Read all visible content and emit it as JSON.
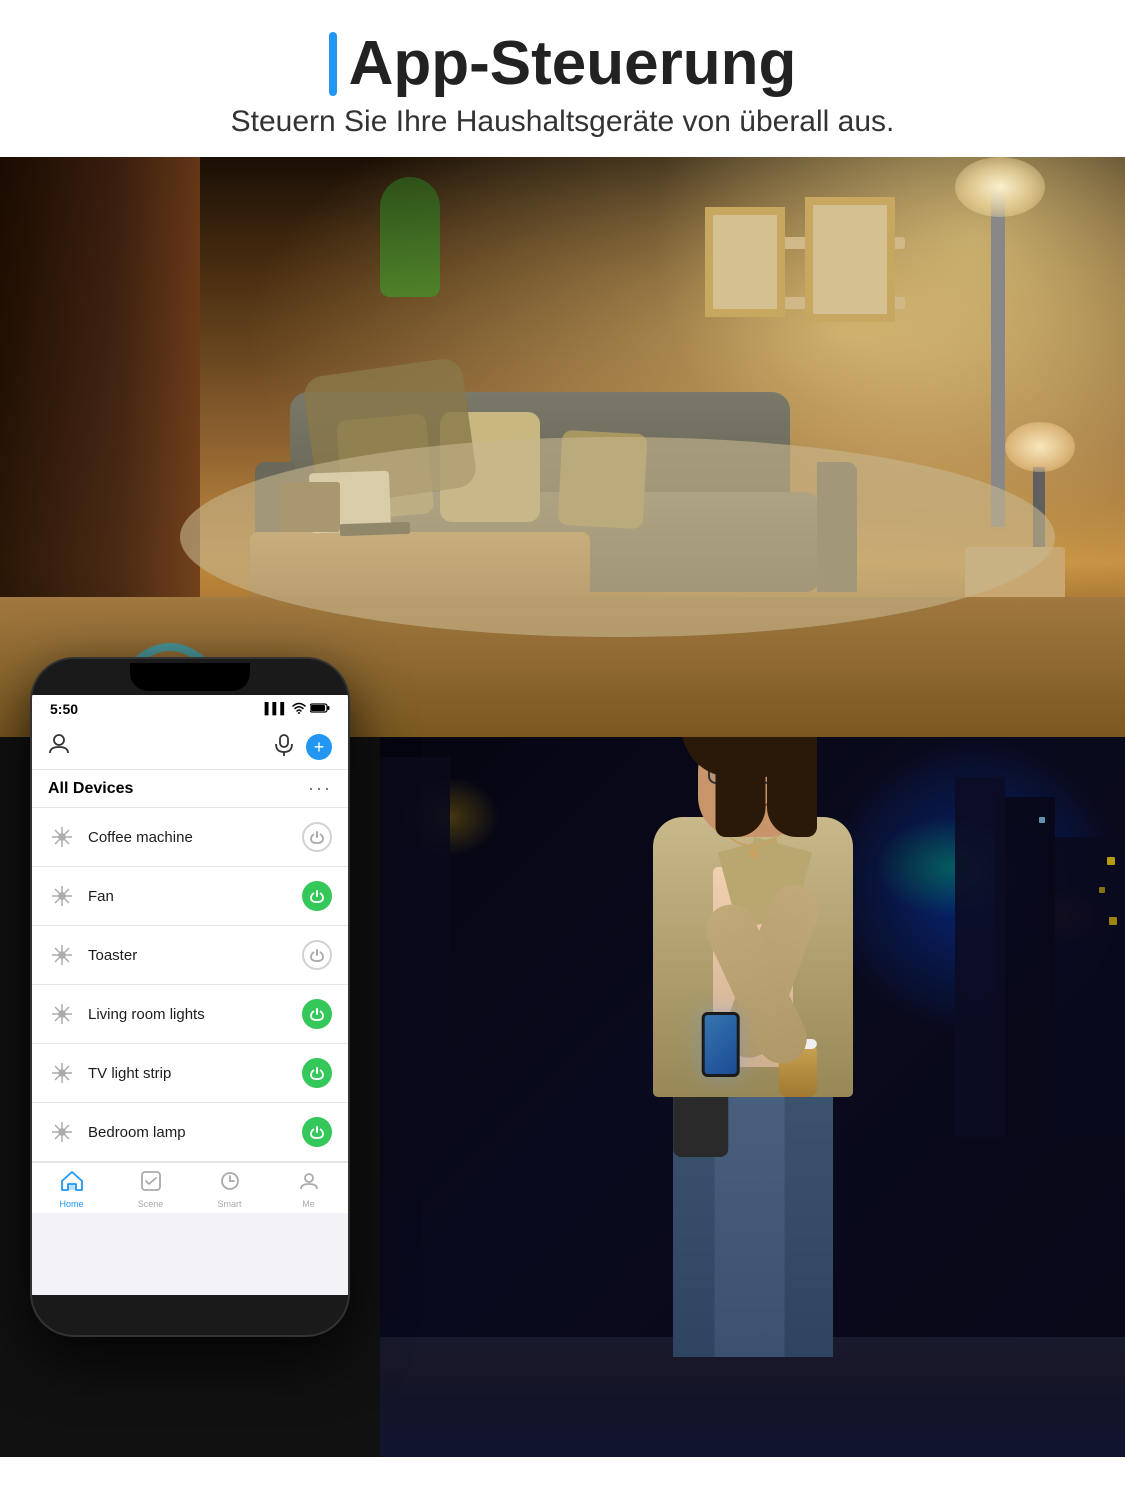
{
  "header": {
    "title": "App-Steuerung",
    "blue_bar": "|",
    "subtitle": "Steuern Sie Ihre Haushaltsgeräte von überall aus."
  },
  "phone": {
    "status": {
      "time": "5:50",
      "signal": "▌▌▌",
      "wifi": "WiFi",
      "battery": "🔋"
    },
    "app_header": {
      "user_icon": "👤",
      "mic_icon": "🎙",
      "plus_icon": "+"
    },
    "devices_section": {
      "title": "All Devices",
      "dots": "···",
      "devices": [
        {
          "name": "Coffee machine",
          "on": false,
          "icon": "❄"
        },
        {
          "name": "Fan",
          "on": true,
          "icon": "❄"
        },
        {
          "name": "Toaster",
          "on": false,
          "icon": "❄"
        },
        {
          "name": "Living room lights",
          "on": true,
          "icon": "❄"
        },
        {
          "name": "TV light strip",
          "on": true,
          "icon": "❄"
        },
        {
          "name": "Bedroom lamp",
          "on": true,
          "icon": "❄"
        }
      ]
    },
    "bottom_nav": [
      {
        "label": "Home",
        "active": true,
        "icon": "⌂"
      },
      {
        "label": "Scene",
        "active": false,
        "icon": "☑"
      },
      {
        "label": "Smart",
        "active": false,
        "icon": "⏲"
      },
      {
        "label": "Me",
        "active": false,
        "icon": "⊙"
      }
    ]
  },
  "wifi_icon": "wifi",
  "room_description": "Cozy living room with warm lighting",
  "woman_description": "Woman using smartphone outdoors at night"
}
